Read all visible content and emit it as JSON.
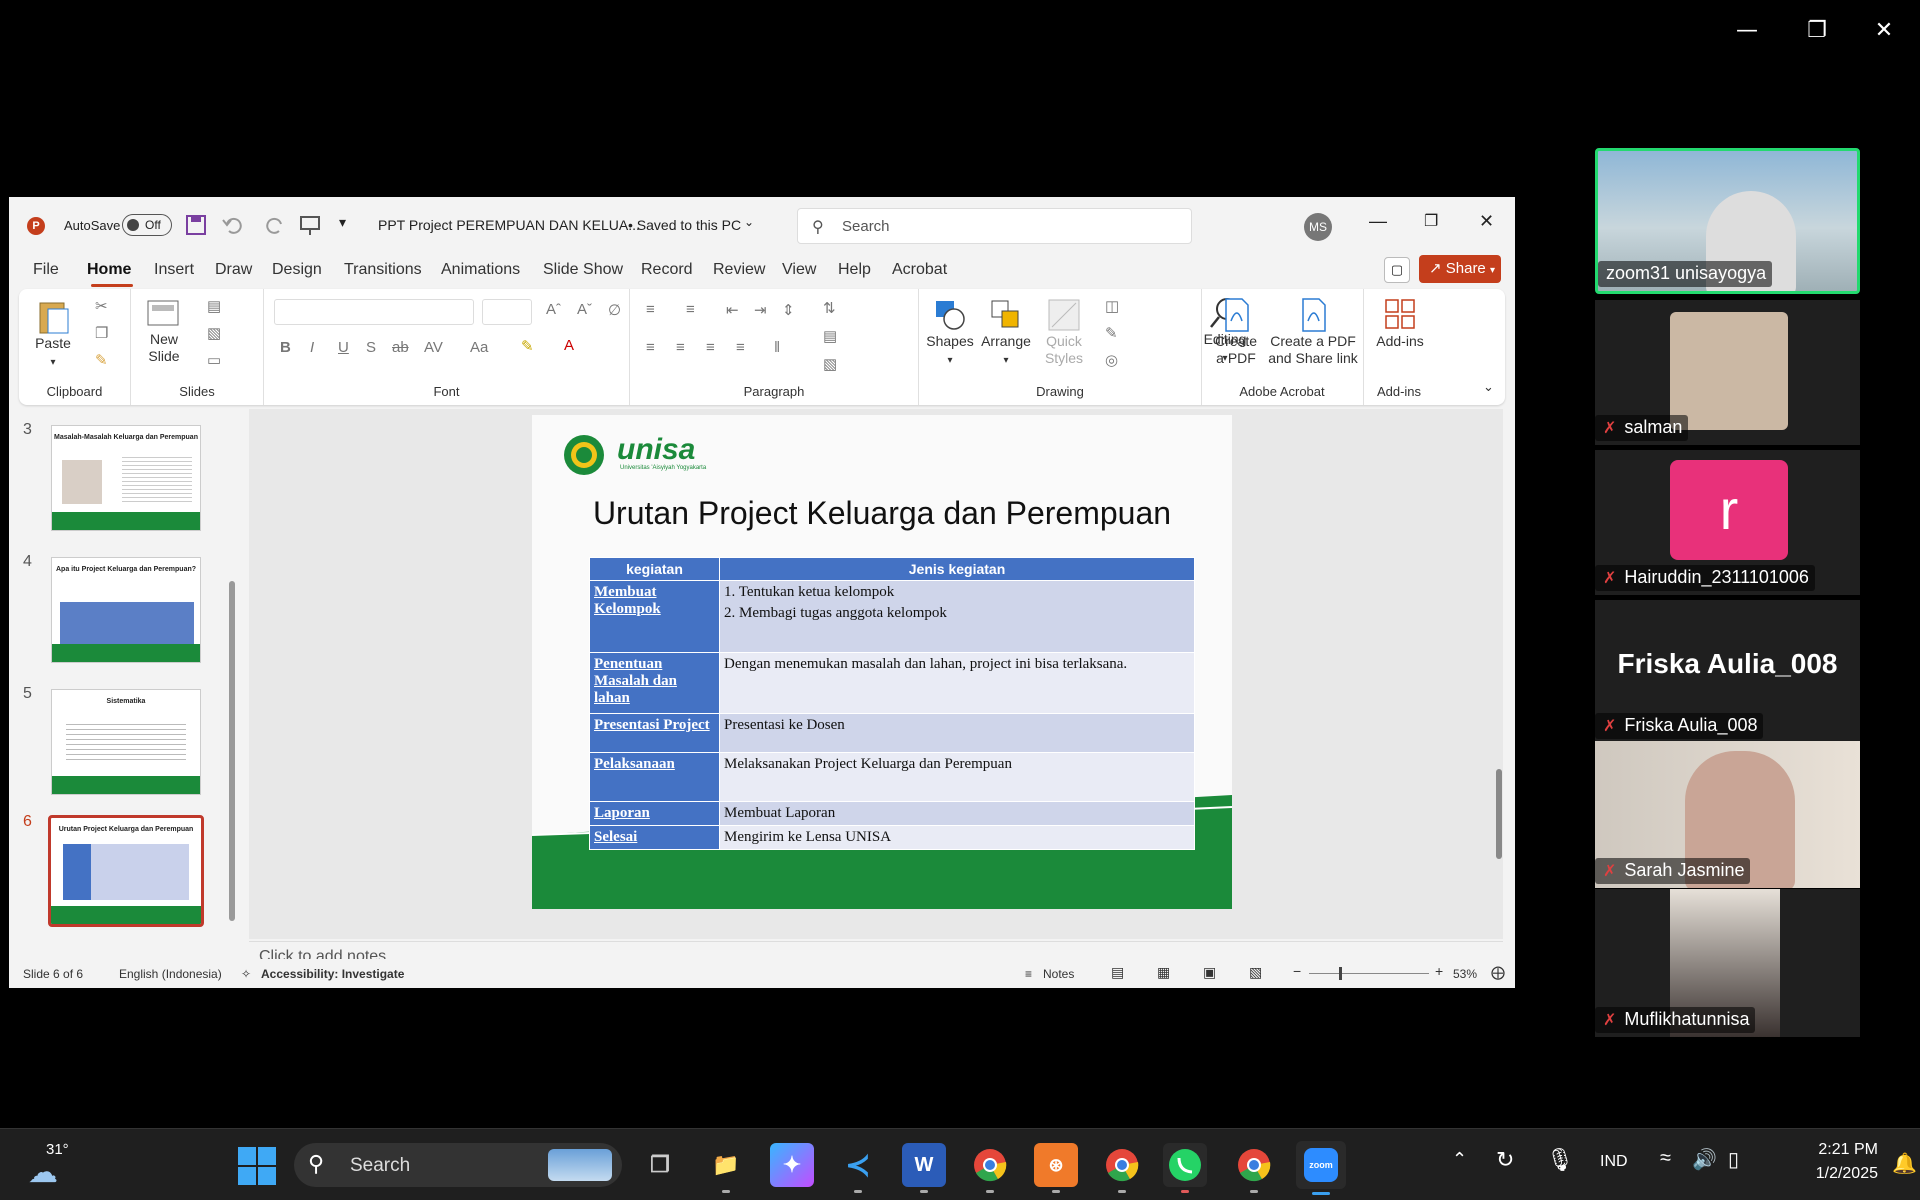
{
  "zoom_window": {
    "controls": [
      "minimize-icon",
      "restore-icon",
      "close-icon"
    ]
  },
  "ppt": {
    "app_icon": "P",
    "autosave_label": "AutoSave",
    "autosave_state": "Off",
    "file_title": "PPT Project PEREMPUAN DAN KELUA...",
    "save_status": "• Saved to this PC",
    "search_placeholder": "Search",
    "user_initials": "MS",
    "share_label": "Share",
    "tabs": [
      "File",
      "Home",
      "Insert",
      "Draw",
      "Design",
      "Transitions",
      "Animations",
      "Slide Show",
      "Record",
      "Review",
      "View",
      "Help",
      "Acrobat"
    ],
    "active_tab": "Home",
    "ribbon": {
      "paste": "Paste",
      "clipboard": "Clipboard",
      "new_slide_1": "New",
      "new_slide_2": "Slide",
      "slides": "Slides",
      "font": "Font",
      "paragraph": "Paragraph",
      "shapes": "Shapes",
      "arrange": "Arrange",
      "quick_styles_1": "Quick",
      "quick_styles_2": "Styles",
      "drawing": "Drawing",
      "editing": "Editing",
      "create_pdf_1": "Create",
      "create_pdf_2": "a PDF",
      "create_share_1": "Create a PDF",
      "create_share_2": "and Share link",
      "adobe_acrobat": "Adobe Acrobat",
      "add_ins_btn": "Add-ins",
      "add_ins": "Add-ins"
    },
    "thumbnails": [
      {
        "num": "3",
        "title": "Masalah-Masalah Keluarga dan Perempuan"
      },
      {
        "num": "4",
        "title": "Apa itu Project Keluarga dan Perempuan?"
      },
      {
        "num": "5",
        "title": "Sistematika"
      },
      {
        "num": "6",
        "title": "Urutan Project Keluarga dan Perempuan"
      }
    ],
    "slide": {
      "logo_text": "unisa",
      "logo_sub": "Universitas 'Aisyiyah Yogyakarta",
      "title": "Urutan Project Keluarga dan Perempuan",
      "headers": [
        "kegiatan",
        "Jenis kegiatan"
      ],
      "rows": [
        {
          "k": "Membuat Kelompok",
          "v1": "1.   Tentukan ketua kelompok",
          "v2": "2.   Membagi tugas anggota kelompok"
        },
        {
          "k": "Penentuan Masalah dan lahan",
          "v1": "Dengan menemukan masalah dan lahan, project ini bisa terlaksana."
        },
        {
          "k": "Presentasi Project",
          "v1": "Presentasi ke Dosen"
        },
        {
          "k": "Pelaksanaan",
          "v1": "Melaksanakan Project Keluarga dan Perempuan"
        },
        {
          "k": "Laporan",
          "v1": "Membuat Laporan"
        },
        {
          "k": "Selesai",
          "v1": "Mengirim ke Lensa UNISA"
        }
      ]
    },
    "notes_placeholder": "Click to add notes",
    "status": {
      "slide": "Slide 6 of 6",
      "language": "English (Indonesia)",
      "accessibility": "Accessibility: Investigate",
      "notes": "Notes",
      "zoom": "53%"
    }
  },
  "participants": [
    {
      "name": "zoom31 unisayogya",
      "muted": false,
      "active": true
    },
    {
      "name": "salman",
      "muted": true
    },
    {
      "name": "Hairuddin_2311101006",
      "muted": true,
      "avatar_letter": "r"
    },
    {
      "name": "Friska Aulia_008",
      "muted": true,
      "display_name": "Friska Aulia_008"
    },
    {
      "name": "Sarah Jasmine",
      "muted": true
    },
    {
      "name": "Muflikhatunnisa",
      "muted": true
    }
  ],
  "taskbar": {
    "weather_temp": "31°",
    "search_label": "Search",
    "language": "IND",
    "time": "2:21 PM",
    "date": "1/2/2025"
  },
  "colors": {
    "ppt_accent": "#c43e1c",
    "table_header": "#4472c4",
    "unisa_green": "#1b8a3a",
    "active_speaker": "#23d96f",
    "avatar_pink": "#e8317a"
  }
}
